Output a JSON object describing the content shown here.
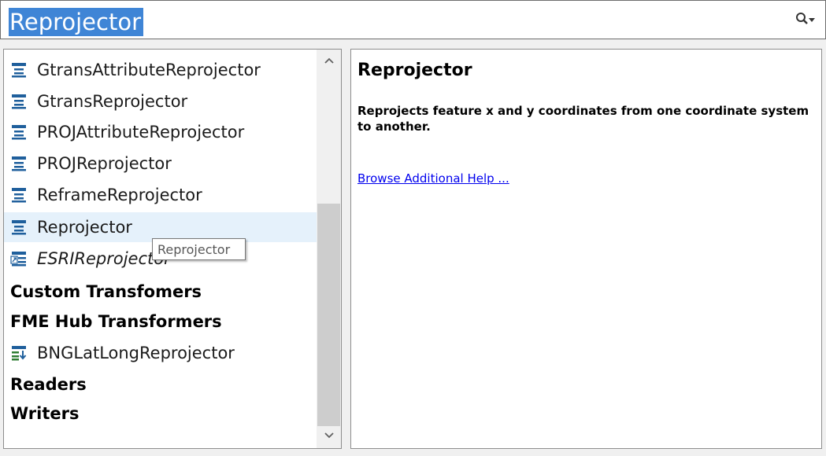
{
  "search": {
    "value": "Reprojector"
  },
  "list": {
    "items": [
      {
        "label": "GtransAttributeReprojector",
        "icon": "transformer-icon",
        "selected": false,
        "italic": false
      },
      {
        "label": "GtransReprojector",
        "icon": "transformer-icon",
        "selected": false,
        "italic": false
      },
      {
        "label": "PROJAttributeReprojector",
        "icon": "transformer-icon",
        "selected": false,
        "italic": false
      },
      {
        "label": "PROJReprojector",
        "icon": "transformer-icon",
        "selected": false,
        "italic": false
      },
      {
        "label": "ReframeReprojector",
        "icon": "transformer-icon",
        "selected": false,
        "italic": false
      },
      {
        "label": "Reprojector",
        "icon": "transformer-icon",
        "selected": true,
        "italic": false
      },
      {
        "label": "ESRIReprojector",
        "icon": "linked-transformer-icon",
        "selected": false,
        "italic": true
      }
    ],
    "categories": {
      "custom": "Custom Transfomers",
      "hub": "FME Hub Transformers",
      "readers": "Readers",
      "writers": "Writers"
    },
    "hub_items": [
      {
        "label": "BNGLatLongReprojector",
        "icon": "download-transformer-icon"
      }
    ]
  },
  "tooltip": {
    "text": "Reprojector"
  },
  "help": {
    "title": "Reprojector",
    "description": "Reprojects feature x and y coordinates from one coordinate system to another.",
    "link": "Browse Additional Help ..."
  },
  "colors": {
    "selection": "#3f85d6",
    "icon_blue": "#1f5f9c",
    "icon_green": "#2e7d32",
    "link": "#0000ee"
  }
}
